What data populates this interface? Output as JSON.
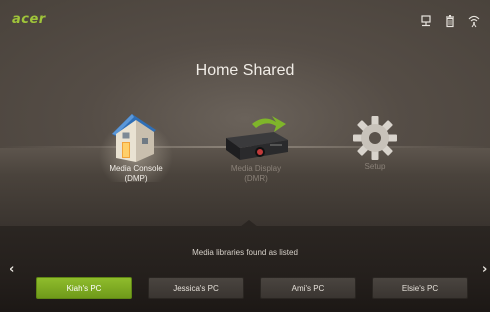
{
  "brand": "acer",
  "status_icons": [
    "network-icon",
    "trash-icon",
    "wifi-icon"
  ],
  "title": "Home Shared",
  "tiles": [
    {
      "line1": "Media Console",
      "line2": "(DMP)",
      "icon": "house-icon",
      "selected": true
    },
    {
      "line1": "Media Display",
      "line2": "(DMR)",
      "icon": "projector-icon",
      "selected": false
    },
    {
      "line1": "Setup",
      "line2": "",
      "icon": "gear-icon",
      "selected": false
    }
  ],
  "libraries_caption": "Media libraries found as listed",
  "nav": {
    "prev": "‹",
    "next": "›"
  },
  "pcs": [
    {
      "label": "Kiah's PC",
      "active": true
    },
    {
      "label": "Jessica's PC",
      "active": false
    },
    {
      "label": "Ami's PC",
      "active": false
    },
    {
      "label": "Elsie's PC",
      "active": false
    }
  ],
  "colors": {
    "brand": "#9fc43a",
    "active": "#7faa22",
    "background": "#4b443d"
  }
}
